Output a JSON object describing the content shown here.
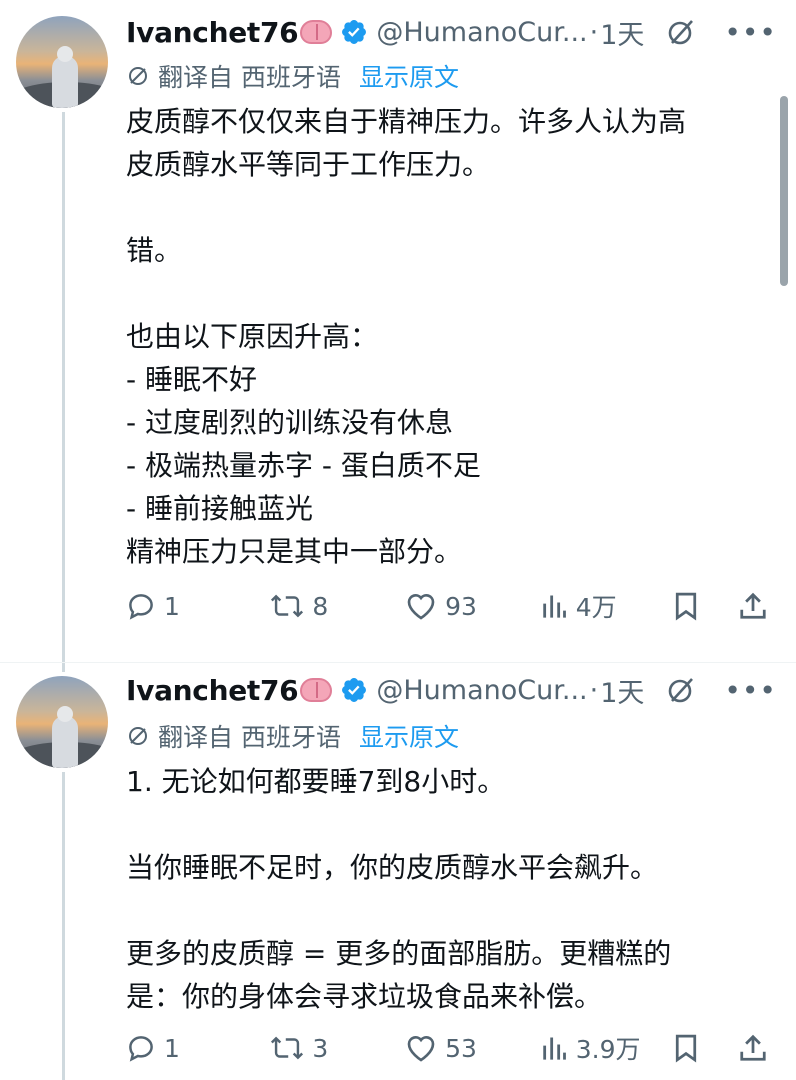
{
  "tweets": [
    {
      "author_name": "Ivanchet76",
      "author_emoji": "brain-emoji",
      "handle": "@HumanoCur...",
      "separator": "·",
      "time": "1天",
      "translate_label": "翻译自 西班牙语",
      "show_original": "显示原文",
      "body": "皮质醇不仅仅来自于精神压力。许多人认为高\n皮质醇水平等同于工作压力。\n\n错。\n\n也由以下原因升高：\n- 睡眠不好\n- 过度剧烈的训练没有休息\n- 极端热量赤字 - 蛋白质不足\n- 睡前接触蓝光\n精神压力只是其中一部分。",
      "replies": "1",
      "retweets": "8",
      "likes": "93",
      "views": "4万"
    },
    {
      "author_name": "Ivanchet76",
      "author_emoji": "brain-emoji",
      "handle": "@HumanoCur...",
      "separator": "·",
      "time": "1天",
      "translate_label": "翻译自 西班牙语",
      "show_original": "显示原文",
      "body": "1. 无论如何都要睡7到8小时。\n\n当你睡眠不足时，你的皮质醇水平会飙升。\n\n更多的皮质醇 = 更多的面部脂肪。更糟糕的\n是：你的身体会寻求垃圾食品来补偿。",
      "replies": "1",
      "retweets": "3",
      "likes": "53",
      "views": "3.9万"
    }
  ],
  "more_icon": "more-icon",
  "colors": {
    "accent": "#1d9bf0",
    "muted": "#536471",
    "text": "#0f1419",
    "thread_line": "#cfd9de"
  }
}
